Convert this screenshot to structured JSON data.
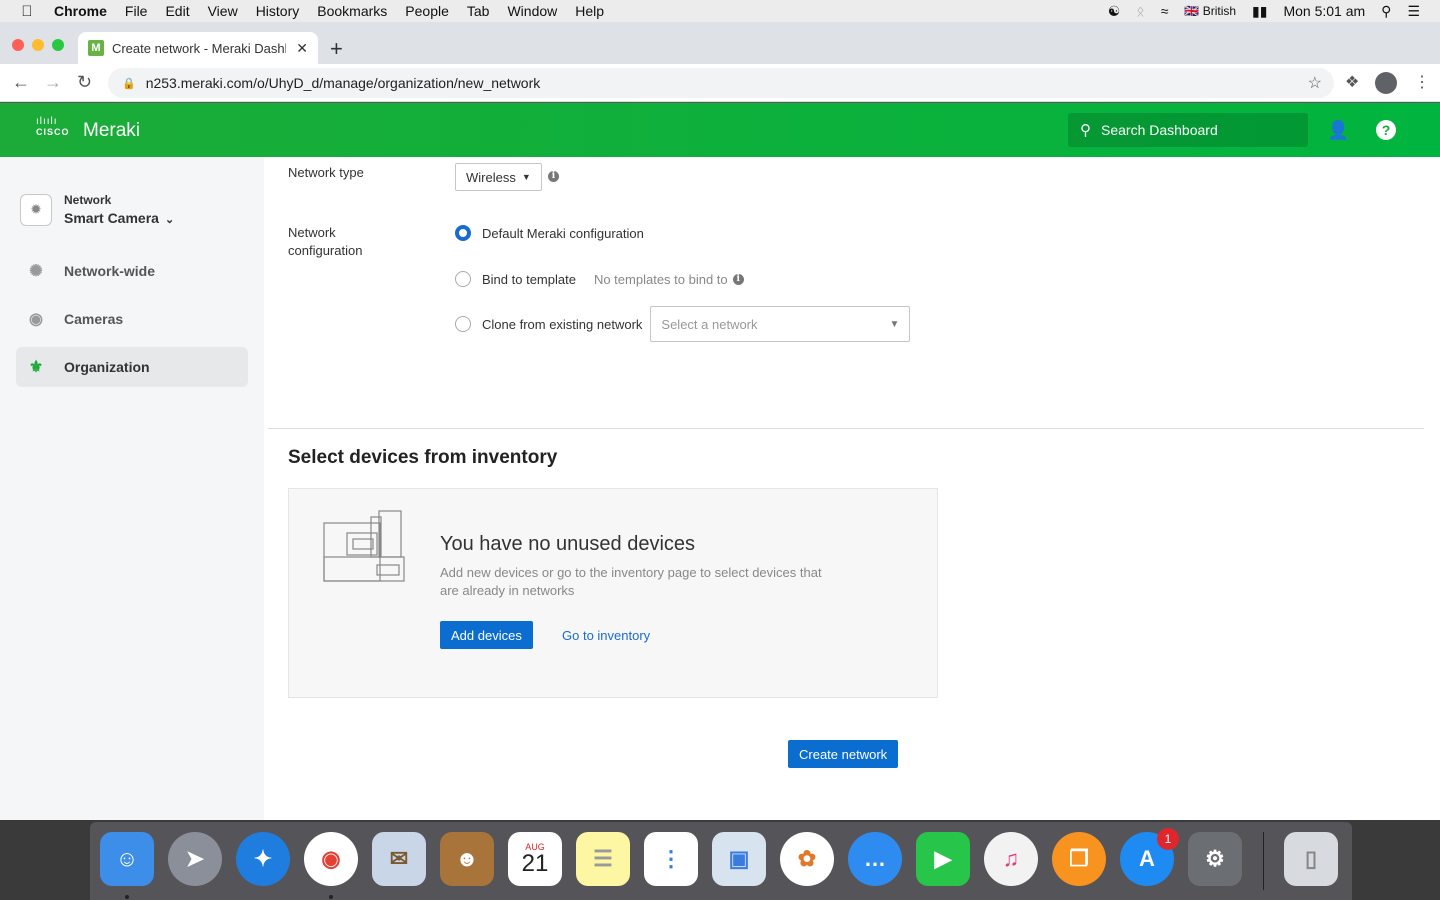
{
  "menubar": {
    "apple": "",
    "items": [
      "Chrome",
      "File",
      "Edit",
      "View",
      "History",
      "Bookmarks",
      "People",
      "Tab",
      "Window",
      "Help"
    ],
    "keyboard": "British",
    "clock": "Mon 5:01 am"
  },
  "browser": {
    "tab_title": "Create network - Meraki Dashboard",
    "favicon_letter": "M",
    "url": "n253.meraki.com/o/UhyD_d/manage/organization/new_network"
  },
  "header": {
    "brand_small": "CISCO",
    "brand": "Meraki",
    "search_placeholder": "Search Dashboard"
  },
  "sidebar": {
    "network_label": "Network",
    "network_name": "Smart Camera",
    "items": [
      {
        "label": "Network-wide",
        "icon": "network-wide-icon"
      },
      {
        "label": "Cameras",
        "icon": "camera-icon"
      },
      {
        "label": "Organization",
        "icon": "organization-icon",
        "active": true
      }
    ]
  },
  "form": {
    "network_type_label": "Network type",
    "network_type_value": "Wireless",
    "network_config_label_1": "Network",
    "network_config_label_2": "configuration",
    "options": {
      "default": "Default Meraki configuration",
      "bind": "Bind to template",
      "bind_note": "No templates to bind to",
      "clone": "Clone from existing network",
      "clone_placeholder": "Select a network"
    },
    "selected_option": "default"
  },
  "inventory": {
    "section_title": "Select devices from inventory",
    "empty_title": "You have no unused devices",
    "empty_desc": "Add new devices or go to the inventory page to select devices that are already in networks",
    "add_button": "Add devices",
    "inventory_link": "Go to inventory"
  },
  "actions": {
    "create_button": "Create network"
  },
  "dock": {
    "calendar_month": "AUG",
    "calendar_day": "21",
    "app_store_badge": "1"
  },
  "colors": {
    "header_green": "#1cab38",
    "primary_blue": "#0a6dcf"
  }
}
